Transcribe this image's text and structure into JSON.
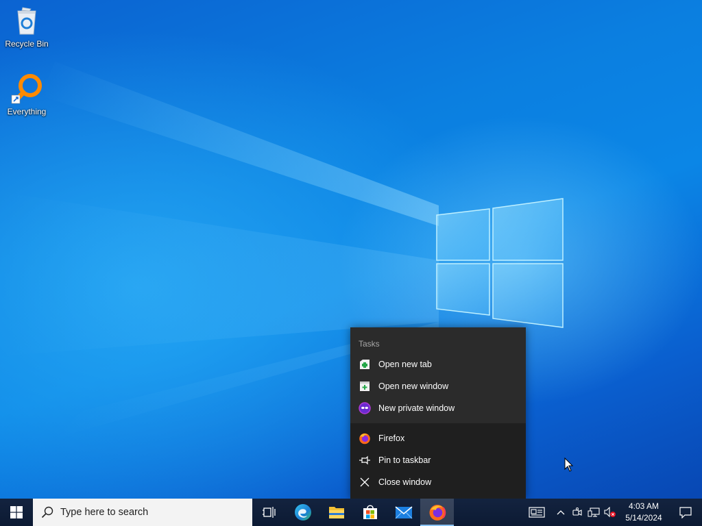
{
  "desktop": {
    "icons": [
      {
        "label": "Recycle Bin",
        "icon": "recycle-bin-icon"
      },
      {
        "label": "Everything",
        "icon": "everything-search-icon"
      }
    ]
  },
  "jumplist": {
    "tasks_header": "Tasks",
    "tasks": [
      {
        "label": "Open new tab",
        "icon": "new-tab-icon"
      },
      {
        "label": "Open new window",
        "icon": "new-window-icon"
      },
      {
        "label": "New private window",
        "icon": "private-window-icon"
      }
    ],
    "app_items": [
      {
        "label": "Firefox",
        "icon": "firefox-icon"
      },
      {
        "label": "Pin to taskbar",
        "icon": "pin-icon"
      },
      {
        "label": "Close window",
        "icon": "close-icon"
      }
    ]
  },
  "taskbar": {
    "search_placeholder": "Type here to search",
    "apps": [
      {
        "name": "Task View",
        "icon": "task-view-icon"
      },
      {
        "name": "Microsoft Edge",
        "icon": "edge-icon"
      },
      {
        "name": "File Explorer",
        "icon": "file-explorer-icon"
      },
      {
        "name": "Microsoft Store",
        "icon": "store-icon"
      },
      {
        "name": "Mail",
        "icon": "mail-icon"
      },
      {
        "name": "Firefox",
        "icon": "firefox-icon",
        "active": true
      }
    ],
    "tray": {
      "time": "4:03 AM",
      "date": "5/14/2024"
    }
  }
}
